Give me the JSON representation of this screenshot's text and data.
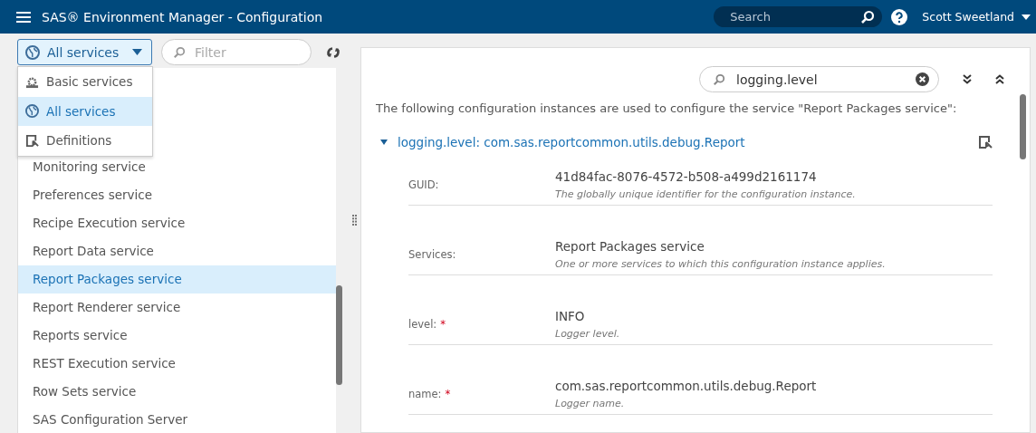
{
  "app_bar": {
    "title": "SAS® Environment Manager - Configuration",
    "search": {
      "placeholder": "Search"
    },
    "user": "Scott Sweetland"
  },
  "left_panel": {
    "view_selector": {
      "label": "All services"
    },
    "filter": {
      "placeholder": "Filter"
    },
    "view_menu": [
      {
        "label": "Basic services",
        "kind": "basic",
        "selected": false
      },
      {
        "label": "All services",
        "kind": "all",
        "selected": true
      },
      {
        "label": "Definitions",
        "kind": "definitions",
        "selected": false
      }
    ],
    "services": [
      {
        "label": "Monitoring service",
        "selected": false
      },
      {
        "label": "Preferences service",
        "selected": false
      },
      {
        "label": "Recipe Execution service",
        "selected": false
      },
      {
        "label": "Report Data service",
        "selected": false
      },
      {
        "label": "Report Packages service",
        "selected": true
      },
      {
        "label": "Report Renderer service",
        "selected": false
      },
      {
        "label": "Reports service",
        "selected": false
      },
      {
        "label": "REST Execution service",
        "selected": false
      },
      {
        "label": "Row Sets service",
        "selected": false
      },
      {
        "label": "SAS Configuration Server",
        "selected": false
      }
    ]
  },
  "detail": {
    "search": {
      "value": "logging.level"
    },
    "intro": "The following configuration instances are used to configure the service \"Report Packages service\":",
    "instance": {
      "expanded": true,
      "key": "logging.level:",
      "name": "com.sas.reportcommon.utils.debug.Report",
      "fields": [
        {
          "label": "GUID:",
          "value": "41d84fac-8076-4572-b508-a499d2161174",
          "hint": "The globally unique identifier for the configuration instance."
        },
        {
          "label": "Services:",
          "value": "Report Packages service",
          "hint": "One or more services to which this configuration instance applies."
        },
        {
          "label": "level:",
          "required_mark": "*",
          "value": "INFO",
          "hint": "Logger level."
        },
        {
          "label": "name:",
          "required_mark": "*",
          "value": "com.sas.reportcommon.utils.debug.Report",
          "hint": "Logger name."
        }
      ]
    }
  }
}
